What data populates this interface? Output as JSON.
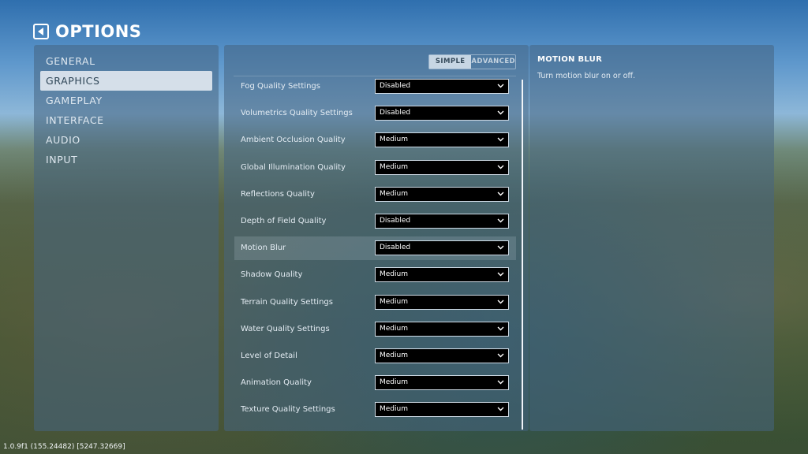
{
  "header": {
    "title": "OPTIONS",
    "back_icon": "back-arrow-icon"
  },
  "nav": {
    "items": [
      {
        "label": "GENERAL",
        "active": false
      },
      {
        "label": "GRAPHICS",
        "active": true
      },
      {
        "label": "GAMEPLAY",
        "active": false
      },
      {
        "label": "INTERFACE",
        "active": false
      },
      {
        "label": "AUDIO",
        "active": false
      },
      {
        "label": "INPUT",
        "active": false
      }
    ]
  },
  "mode_toggle": {
    "simple": "SIMPLE",
    "advanced": "ADVANCED",
    "selected": "simple"
  },
  "settings": [
    {
      "label": "Fog Quality Settings",
      "value": "Disabled"
    },
    {
      "label": "Volumetrics Quality Settings",
      "value": "Disabled"
    },
    {
      "label": "Ambient Occlusion Quality",
      "value": "Medium"
    },
    {
      "label": "Global Illumination Quality",
      "value": "Medium"
    },
    {
      "label": "Reflections Quality",
      "value": "Medium"
    },
    {
      "label": "Depth of Field Quality",
      "value": "Disabled"
    },
    {
      "label": "Motion Blur",
      "value": "Disabled",
      "highlighted": true
    },
    {
      "label": "Shadow Quality",
      "value": "Medium"
    },
    {
      "label": "Terrain Quality Settings",
      "value": "Medium"
    },
    {
      "label": "Water Quality Settings",
      "value": "Medium"
    },
    {
      "label": "Level of Detail",
      "value": "Medium"
    },
    {
      "label": "Animation Quality",
      "value": "Medium"
    },
    {
      "label": "Texture Quality Settings",
      "value": "Medium"
    }
  ],
  "description": {
    "title": "MOTION BLUR",
    "text": "Turn motion blur on or off."
  },
  "footer": {
    "version": "1.0.9f1 (155.24482) [5247.32669]"
  },
  "colors": {
    "panel": "#46648280",
    "active_nav": "#e6ecf2",
    "select_bg": "#000000"
  }
}
